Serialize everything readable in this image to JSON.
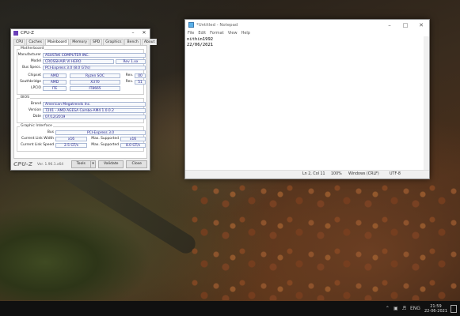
{
  "cpuz": {
    "title": "CPU-Z",
    "tabs": [
      "CPU",
      "Caches",
      "Mainboard",
      "Memory",
      "SPD",
      "Graphics",
      "Bench",
      "About"
    ],
    "active_tab": "Mainboard",
    "motherboard": {
      "group_title": "Motherboard",
      "manufacturer_label": "Manufacturer",
      "manufacturer": "ASUSTeK COMPUTER INC.",
      "model_label": "Model",
      "model": "CROSSHAIR VI HERO",
      "model_rev": "Rev 1.xx",
      "bus_specs_label": "Bus Specs.",
      "bus_specs": "PCI-Express 3.0 (8.0 GT/s)",
      "chipset_label": "Chipset",
      "chipset_vendor": "AMD",
      "chipset_name": "Ryzen SOC",
      "rev_label": "Rev.",
      "chipset_rev": "00",
      "southbridge_label": "Southbridge",
      "southbridge_vendor": "AMD",
      "southbridge_name": "X370",
      "southbridge_rev": "51",
      "lpcio_label": "LPCIO",
      "lpcio_vendor": "ITE",
      "lpcio_name": "IT8665"
    },
    "bios": {
      "group_title": "BIOS",
      "brand_label": "Brand",
      "brand": "American Megatrends Inc.",
      "version_label": "Version",
      "version": "7201 - AMD AGESA Combo-AM4 1.0.0.2",
      "date_label": "Date",
      "date": "07/12/2019"
    },
    "graphic": {
      "group_title": "Graphic Interface",
      "bus_label": "Bus",
      "bus": "PCI-Express 3.0",
      "link_width_label": "Current Link Width",
      "link_width": "x16",
      "max_supported_label": "Max. Supported",
      "max_width": "x16",
      "link_speed_label": "Current Link Speed",
      "link_speed": "2.5 GT/s",
      "max_speed": "8.0 GT/s"
    },
    "footer": {
      "logo": "CPU-Z",
      "version": "Ver. 1.96.1.x64",
      "tools_label": "Tools",
      "validate_label": "Validate",
      "close_label": "Close"
    }
  },
  "notepad": {
    "title": "*Untitled - Notepad",
    "menu": [
      "File",
      "Edit",
      "Format",
      "View",
      "Help"
    ],
    "lines": [
      "nithin1992",
      "22/06/2021"
    ],
    "status": {
      "position": "Ln 2, Col 11",
      "zoom": "100%",
      "line_ending": "Windows (CRLF)",
      "encoding": "UTF-8"
    }
  },
  "taskbar": {
    "language": "ENG",
    "time": "21:59",
    "date": "22-06-2021"
  }
}
